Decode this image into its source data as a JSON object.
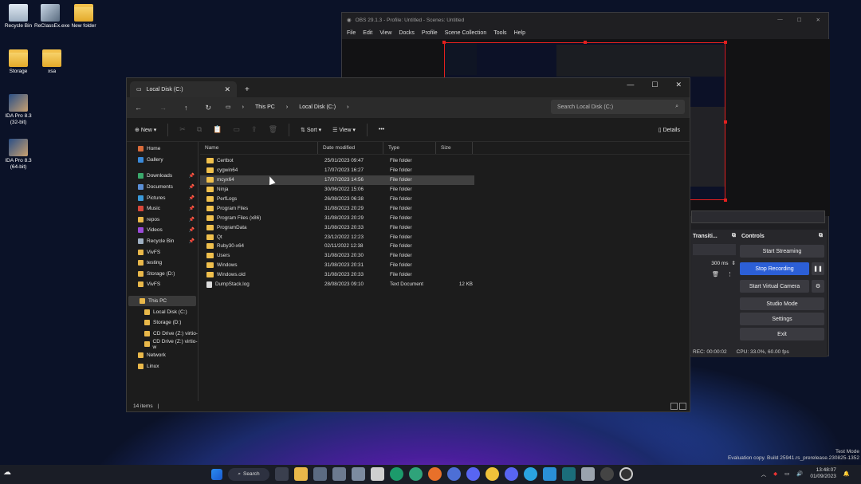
{
  "desktop": {
    "icons": [
      {
        "label": "Recycle Bin",
        "kind": "bin"
      },
      {
        "label": "ReClassEx.exe",
        "kind": "app"
      },
      {
        "label": "New folder",
        "kind": "folder"
      },
      {
        "label": "Storage",
        "kind": "folder"
      },
      {
        "label": "xsa",
        "kind": "folder"
      },
      {
        "label": "IDA Pro 8.3 (32-bit)",
        "kind": "ida"
      },
      {
        "label": "IDA Pro 8.3 (64-bit)",
        "kind": "ida"
      }
    ]
  },
  "obs": {
    "title": "OBS 29.1.3 - Profile: Untitled - Scenes: Untitled",
    "menu": [
      "File",
      "Edit",
      "View",
      "Docks",
      "Profile",
      "Scene Collection",
      "Tools",
      "Help"
    ],
    "transitions_header": "Transiti...",
    "transition_duration": "300 ms",
    "controls_header": "Controls",
    "buttons": [
      "Start Streaming",
      "Stop Recording",
      "Start Virtual Camera",
      "Studio Mode",
      "Settings",
      "Exit"
    ],
    "status_rec": "REC: 00:00:02",
    "status_cpu": "CPU: 33.0%, 60.00 fps"
  },
  "explorer": {
    "tab_title": "Local Disk (C:)",
    "breadcrumb": [
      "This PC",
      "Local Disk (C:)"
    ],
    "search_placeholder": "Search Local Disk (C:)",
    "toolbar": {
      "new": "New",
      "sort": "Sort",
      "view": "View",
      "more": "•••",
      "details": "Details"
    },
    "nav": {
      "top": [
        "Home",
        "Gallery"
      ],
      "quick": [
        {
          "label": "Downloads",
          "pinned": true
        },
        {
          "label": "Documents",
          "pinned": true
        },
        {
          "label": "Pictures",
          "pinned": true
        },
        {
          "label": "Music",
          "pinned": true
        },
        {
          "label": "repos",
          "pinned": true
        },
        {
          "label": "Videos",
          "pinned": true
        },
        {
          "label": "Recycle Bin",
          "pinned": true
        },
        {
          "label": "VivFS",
          "pinned": false
        },
        {
          "label": "testing",
          "pinned": false
        },
        {
          "label": "Storage (D:)",
          "pinned": false
        },
        {
          "label": "VivFS",
          "pinned": false
        }
      ],
      "pc": [
        "This PC",
        "Local Disk (C:)",
        "Storage (D:)",
        "CD Drive (Z:) virtio-",
        "CD Drive (Z:) virtio-w",
        "Network",
        "Linux"
      ]
    },
    "columns": [
      "Name",
      "Date modified",
      "Type",
      "Size"
    ],
    "rows": [
      {
        "name": "Certbot",
        "date": "25/01/2023 09:47",
        "type": "File folder",
        "size": ""
      },
      {
        "name": "cygwin64",
        "date": "17/07/2023 16:27",
        "type": "File folder",
        "size": ""
      },
      {
        "name": "mcyx64",
        "date": "17/07/2023 14:56",
        "type": "File folder",
        "size": ""
      },
      {
        "name": "Ninja",
        "date": "30/06/2022 15:06",
        "type": "File folder",
        "size": ""
      },
      {
        "name": "PerfLogs",
        "date": "26/08/2023 06:38",
        "type": "File folder",
        "size": ""
      },
      {
        "name": "Program Files",
        "date": "31/08/2023 20:29",
        "type": "File folder",
        "size": ""
      },
      {
        "name": "Program Files (x86)",
        "date": "31/08/2023 20:29",
        "type": "File folder",
        "size": ""
      },
      {
        "name": "ProgramData",
        "date": "31/08/2023 20:33",
        "type": "File folder",
        "size": ""
      },
      {
        "name": "Qt",
        "date": "23/12/2022 12:23",
        "type": "File folder",
        "size": ""
      },
      {
        "name": "Ruby30-x64",
        "date": "02/11/2022 12:38",
        "type": "File folder",
        "size": ""
      },
      {
        "name": "Users",
        "date": "31/08/2023 20:30",
        "type": "File folder",
        "size": ""
      },
      {
        "name": "Windows",
        "date": "31/08/2023 20:31",
        "type": "File folder",
        "size": ""
      },
      {
        "name": "Windows.old",
        "date": "31/08/2023 20:33",
        "type": "File folder",
        "size": ""
      },
      {
        "name": "DumpStack.log",
        "date": "28/08/2023 09:10",
        "type": "Text Document",
        "size": "12 KB"
      }
    ],
    "selected_row": 2,
    "status": "14 items"
  },
  "taskbar": {
    "search": "Search",
    "time": "13:48:07",
    "date": "01/09/2023"
  },
  "watermark": {
    "line1": "Test Mode",
    "line2": "Evaluation copy. Build 25941.rs_prerelease.230825-1352"
  }
}
